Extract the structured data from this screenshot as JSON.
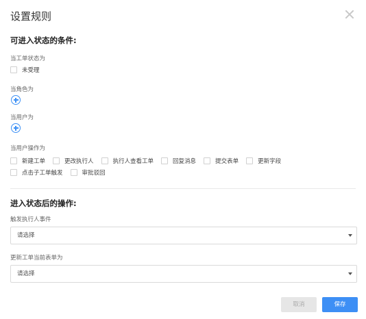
{
  "dialog": {
    "title": "设置规则"
  },
  "enter_conditions": {
    "title": "可进入状态的条件:",
    "ticket_status": {
      "label": "当工单状态为",
      "options": [
        "未受理"
      ]
    },
    "role": {
      "label": "当角色为"
    },
    "user": {
      "label": "当用户为"
    },
    "user_operation": {
      "label": "当用户操作为",
      "row1": [
        "新建工单",
        "更改执行人",
        "执行人查看工单",
        "回复消息",
        "提交表单",
        "更新字段"
      ],
      "row2": [
        "点击子工单触发",
        "审批驳回"
      ]
    }
  },
  "after_enter": {
    "title": "进入状态后的操作:",
    "trigger_event": {
      "label": "触发执行人事件",
      "placeholder": "请选择"
    },
    "update_form": {
      "label": "更新工单当前表单为",
      "placeholder": "请选择"
    }
  },
  "footer": {
    "cancel": "取消",
    "save": "保存"
  },
  "colors": {
    "accent": "#3d8ff5",
    "cancel_bg": "#e6e6e6"
  },
  "icons": {
    "close": "close-icon",
    "add": "plus-circle-icon",
    "dropdown": "caret-down-icon"
  }
}
